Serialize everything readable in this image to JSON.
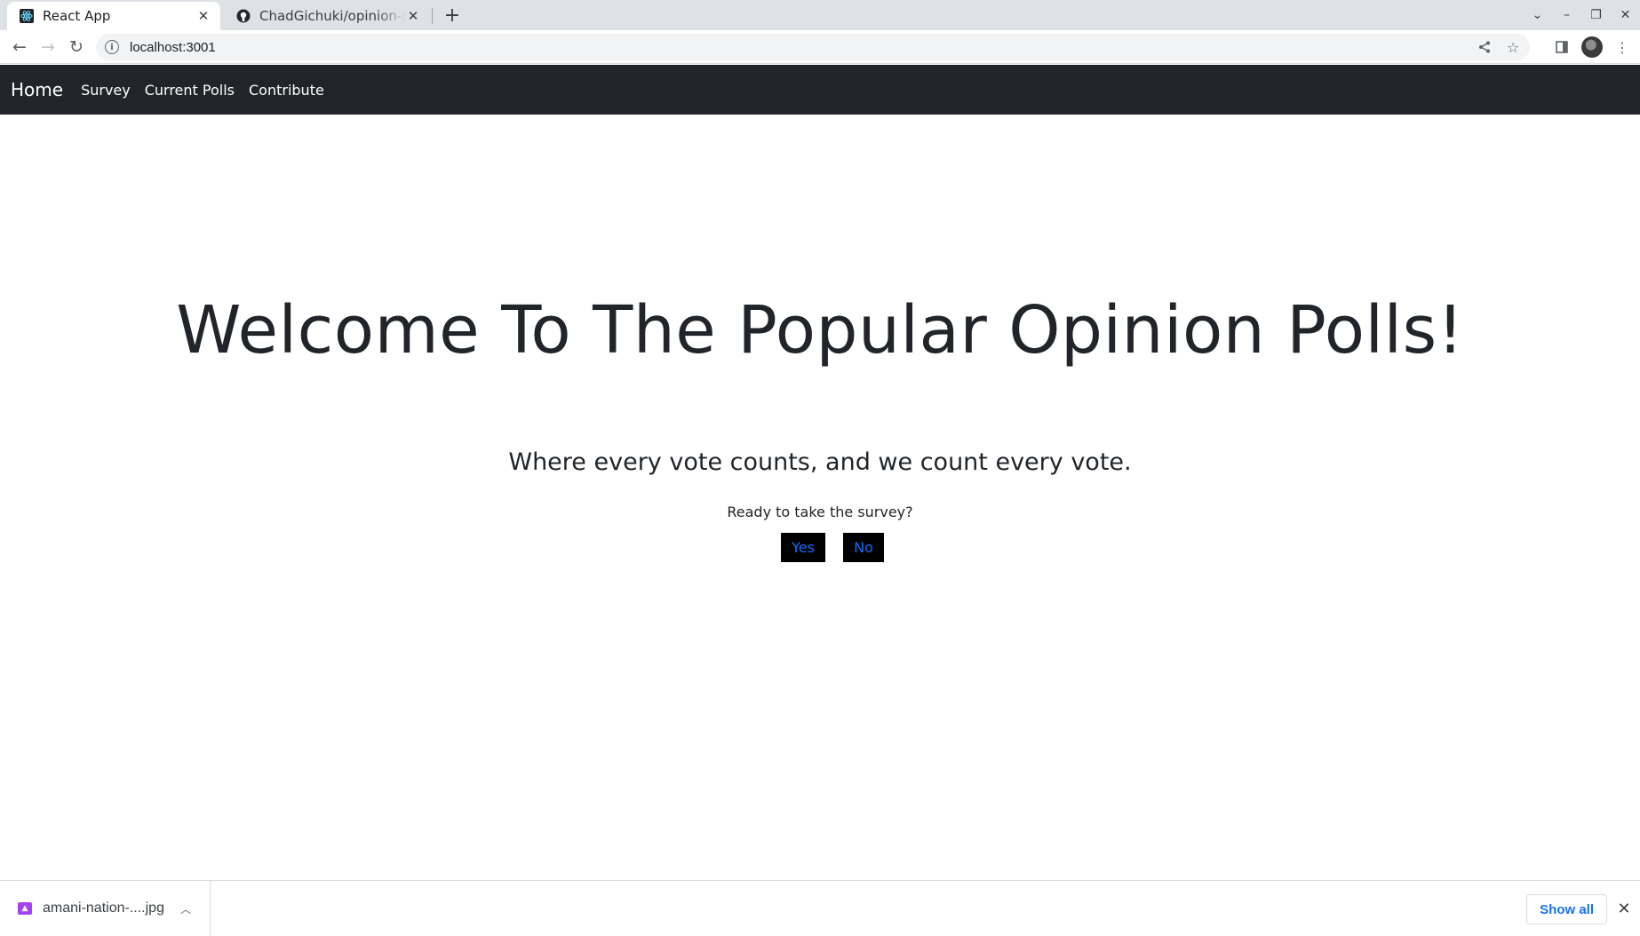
{
  "browser": {
    "tabs": [
      {
        "title": "React App",
        "favicon": "react-icon",
        "active": true
      },
      {
        "title": "ChadGichuki/opinion-polls",
        "favicon": "github-icon",
        "active": false
      }
    ],
    "url": "localhost:3001"
  },
  "navbar": {
    "brand": "Home",
    "links": [
      "Survey",
      "Current Polls",
      "Contribute"
    ]
  },
  "main": {
    "heading": "Welcome To The Popular Opinion Polls!",
    "tagline": "Where every vote counts, and we count every vote.",
    "prompt": "Ready to take the survey?",
    "yes_label": "Yes",
    "no_label": "No"
  },
  "downloads": {
    "file_name": "amani-nation-....jpg",
    "show_all_label": "Show all"
  },
  "colors": {
    "navbar_bg": "#212529",
    "button_bg": "#000000",
    "button_text": "#0d6efd",
    "link_blue": "#1a73e8"
  }
}
